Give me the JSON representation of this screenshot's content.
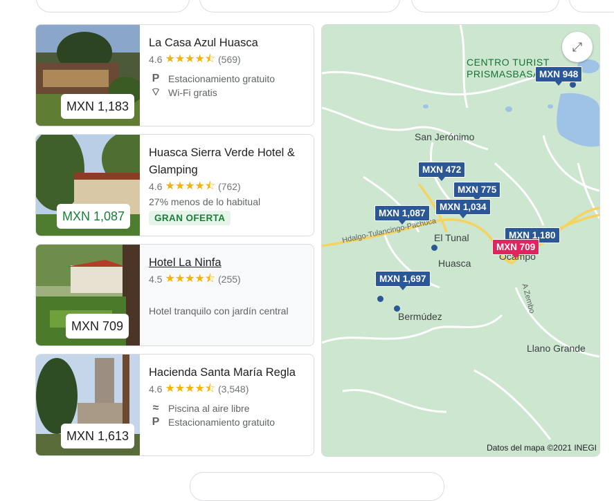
{
  "hotels": [
    {
      "name": "La Casa Azul Huasca",
      "rating": "4.6",
      "stars": "★★★★⯪",
      "reviews": "(569)",
      "price": "MXN 1,183",
      "amenities": [
        {
          "icon": "parking-icon",
          "glyph": "P",
          "label": "Estacionamiento gratuito"
        },
        {
          "icon": "wifi-icon",
          "glyph": "⌔",
          "label": "Wi-Fi gratis"
        }
      ]
    },
    {
      "name": "Huasca Sierra Verde Hotel & Glamping",
      "rating": "4.6",
      "stars": "★★★★⯪",
      "reviews": "(762)",
      "price": "MXN 1,087",
      "deal_text": "27% menos de lo habitual",
      "deal_badge": "GRAN OFERTA"
    },
    {
      "name": "Hotel La Ninfa",
      "rating": "4.5",
      "stars": "★★★★⯪",
      "reviews": "(255)",
      "price": "MXN 709",
      "description": "Hotel tranquilo con jardín central"
    },
    {
      "name": "Hacienda Santa María Regla",
      "rating": "4.6",
      "stars": "★★★★⯪",
      "reviews": "(3,548)",
      "price": "MXN 1,613",
      "amenities": [
        {
          "icon": "pool-icon",
          "glyph": "≈",
          "label": "Piscina al aire libre"
        },
        {
          "icon": "parking-icon",
          "glyph": "P",
          "label": "Estacionamiento gratuito"
        }
      ]
    }
  ],
  "map": {
    "poi": "CENTRO TURIST\nPRISMASBASA",
    "places": [
      "San Jerónimo",
      "El Tunal",
      "Huasca",
      "Bermúdez",
      "Llano Grande",
      "A Zembo",
      "Ocampo"
    ],
    "road": "Hdalgo-Tulancingo-Pachuca",
    "pins": [
      {
        "label": "MXN 948"
      },
      {
        "label": "MXN 472"
      },
      {
        "label": "MXN 775"
      },
      {
        "label": "MXN 1,087"
      },
      {
        "label": "MXN 1,034"
      },
      {
        "label": "MXN 1,180"
      },
      {
        "label": "MXN 709",
        "selected": true
      },
      {
        "label": "MXN 1,697"
      }
    ],
    "attribution": "Datos del mapa ©2021 INEGI"
  },
  "colors": {
    "pin": "#2b5797",
    "pin_selected": "#e0245e",
    "star": "#f4b400",
    "deal_green": "#188038"
  }
}
